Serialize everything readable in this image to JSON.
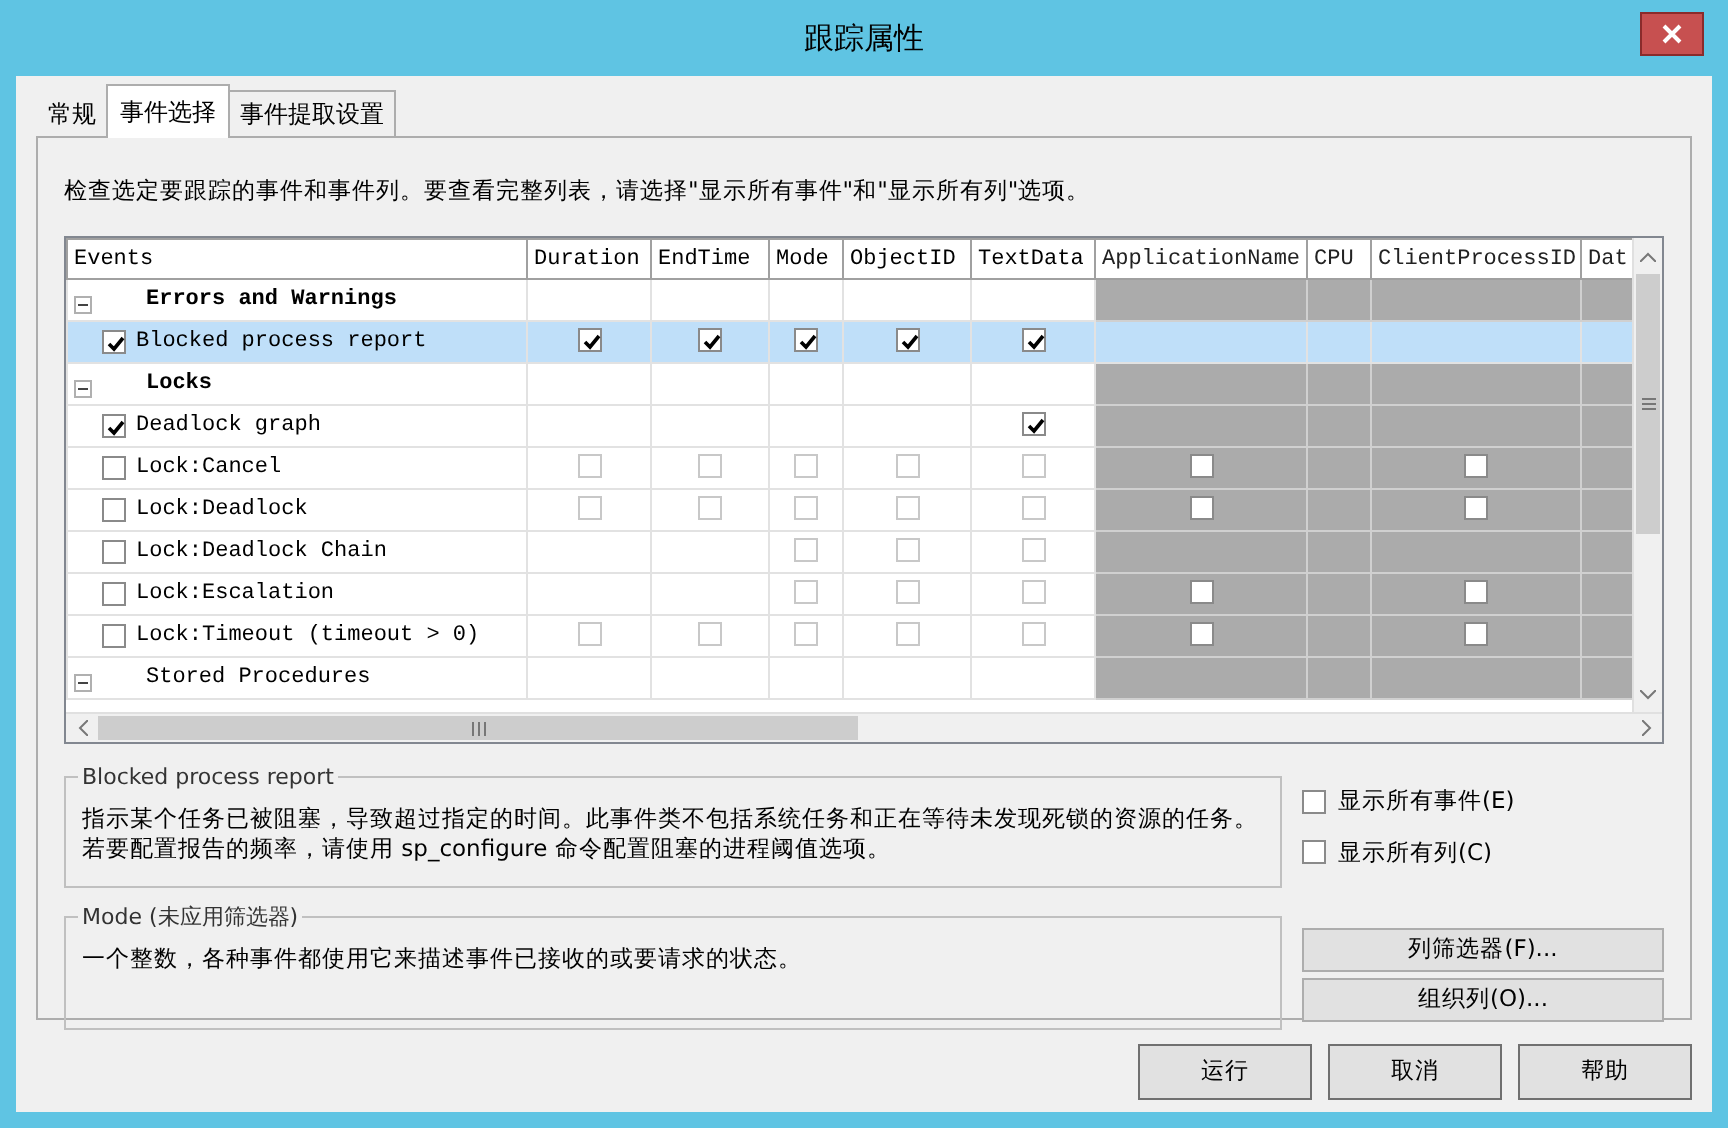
{
  "window": {
    "title": "跟踪属性"
  },
  "tabs": [
    {
      "label": "常规",
      "selected": false
    },
    {
      "label": "事件选择",
      "selected": true
    },
    {
      "label": "事件提取设置",
      "selected": false
    }
  ],
  "instructions": "检查选定要跟踪的事件和事件列。要查看完整列表，请选择\"显示所有事件\"和\"显示所有列\"选项。",
  "grid": {
    "columns": [
      {
        "label": "Events",
        "greyed": false
      },
      {
        "label": "Duration",
        "greyed": false
      },
      {
        "label": "EndTime",
        "greyed": false
      },
      {
        "label": "Mode",
        "greyed": false
      },
      {
        "label": "ObjectID",
        "greyed": false
      },
      {
        "label": "TextData",
        "greyed": false
      },
      {
        "label": "ApplicationName",
        "greyed": true
      },
      {
        "label": "CPU",
        "greyed": true
      },
      {
        "label": "ClientProcessID",
        "greyed": true
      },
      {
        "label": "Dat",
        "greyed": true
      }
    ],
    "rows": [
      {
        "kind": "category",
        "label": "Errors and Warnings",
        "bold": true,
        "expanded": true
      },
      {
        "kind": "event",
        "label": "Blocked process report",
        "checked": true,
        "selected": true,
        "cells": [
          true,
          true,
          true,
          true,
          true,
          null,
          null,
          null,
          null
        ]
      },
      {
        "kind": "category",
        "label": "Locks",
        "bold": true,
        "expanded": true
      },
      {
        "kind": "event",
        "label": "Deadlock graph",
        "checked": true,
        "selected": false,
        "cells": [
          null,
          null,
          null,
          null,
          true,
          null,
          null,
          null,
          null
        ]
      },
      {
        "kind": "event",
        "label": "Lock:Cancel",
        "checked": false,
        "selected": false,
        "cells": [
          false,
          false,
          false,
          false,
          false,
          false,
          null,
          false,
          null
        ]
      },
      {
        "kind": "event",
        "label": "Lock:Deadlock",
        "checked": false,
        "selected": false,
        "cells": [
          false,
          false,
          false,
          false,
          false,
          false,
          null,
          false,
          null
        ]
      },
      {
        "kind": "event",
        "label": "Lock:Deadlock Chain",
        "checked": false,
        "selected": false,
        "cells": [
          null,
          null,
          false,
          false,
          false,
          null,
          null,
          null,
          null
        ]
      },
      {
        "kind": "event",
        "label": "Lock:Escalation",
        "checked": false,
        "selected": false,
        "cells": [
          null,
          null,
          false,
          false,
          false,
          false,
          null,
          false,
          null
        ]
      },
      {
        "kind": "event",
        "label": "Lock:Timeout (timeout > 0)",
        "checked": false,
        "selected": false,
        "cells": [
          false,
          false,
          false,
          false,
          false,
          false,
          null,
          false,
          null
        ]
      },
      {
        "kind": "category",
        "label": "Stored Procedures",
        "bold": false,
        "expanded": true
      }
    ]
  },
  "descriptions": [
    {
      "title": "Blocked process report",
      "text": "指示某个任务已被阻塞，导致超过指定的时间。此事件类不包括系统任务和正在等待未发现死锁的资源的任务。若要配置报告的频率，请使用 sp_configure 命令配置阻塞的进程阈值选项。"
    },
    {
      "title": "Mode (未应用筛选器)",
      "text": "一个整数，各种事件都使用它来描述事件已接收的或要请求的状态。"
    }
  ],
  "options": [
    {
      "label": "显示所有事件(E)",
      "checked": false
    },
    {
      "label": "显示所有列(C)",
      "checked": false
    }
  ],
  "side_buttons": [
    "列筛选器(F)...",
    "组织列(O)..."
  ],
  "footer_buttons": [
    "运行",
    "取消",
    "帮助"
  ]
}
